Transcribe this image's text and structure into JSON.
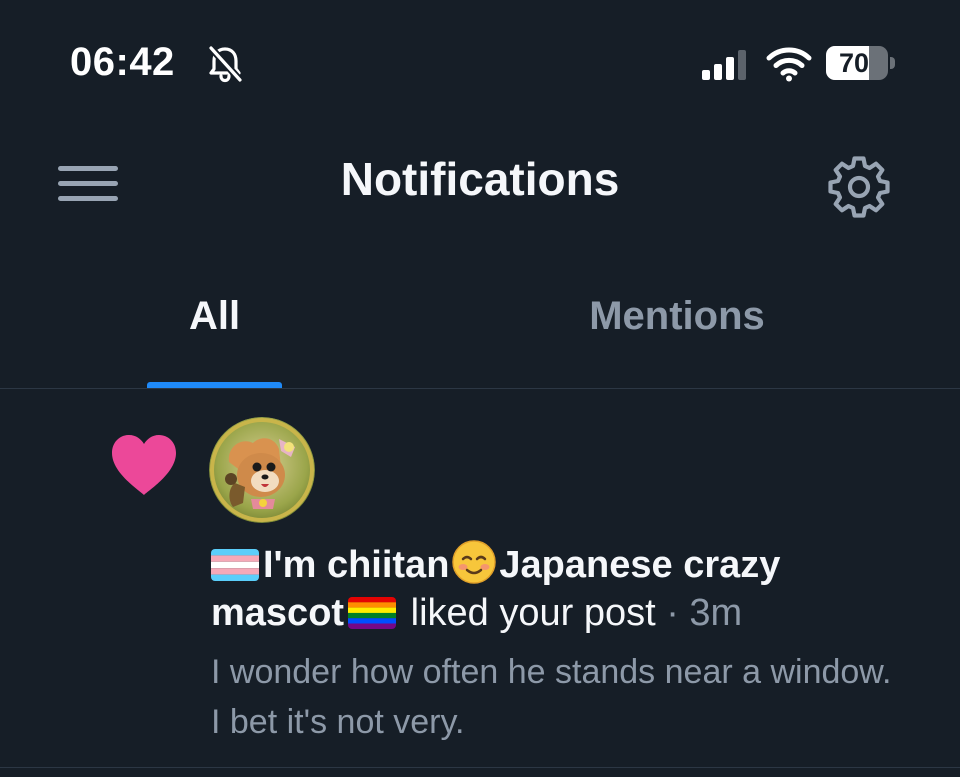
{
  "status_bar": {
    "time": "06:42",
    "battery_level": "70",
    "battery_fraction": 0.7,
    "icons": [
      "bell-off-icon",
      "cellular-signal-icon",
      "wifi-icon",
      "battery-icon"
    ]
  },
  "header": {
    "title": "Notifications",
    "menu_icon": "hamburger-menu-icon",
    "settings_icon": "gear-icon"
  },
  "tabs": [
    {
      "label": "All",
      "selected": true
    },
    {
      "label": "Mentions",
      "selected": false
    }
  ],
  "notification": {
    "type_icon": "heart-icon",
    "author_name_part1": "I'm chiitan",
    "author_name_part2": "Japanese crazy mascot",
    "action": "liked your post",
    "separator": "·",
    "time_ago": "3m",
    "post_preview": "I wonder how often he stands near a window. I bet it's not very."
  },
  "colors": {
    "background": "#161e27",
    "accent": "#1f8af8",
    "heart": "#ec4899",
    "muted_text": "#8d99a8",
    "primary_text": "#f5f7fa",
    "divider": "#2c3744"
  }
}
